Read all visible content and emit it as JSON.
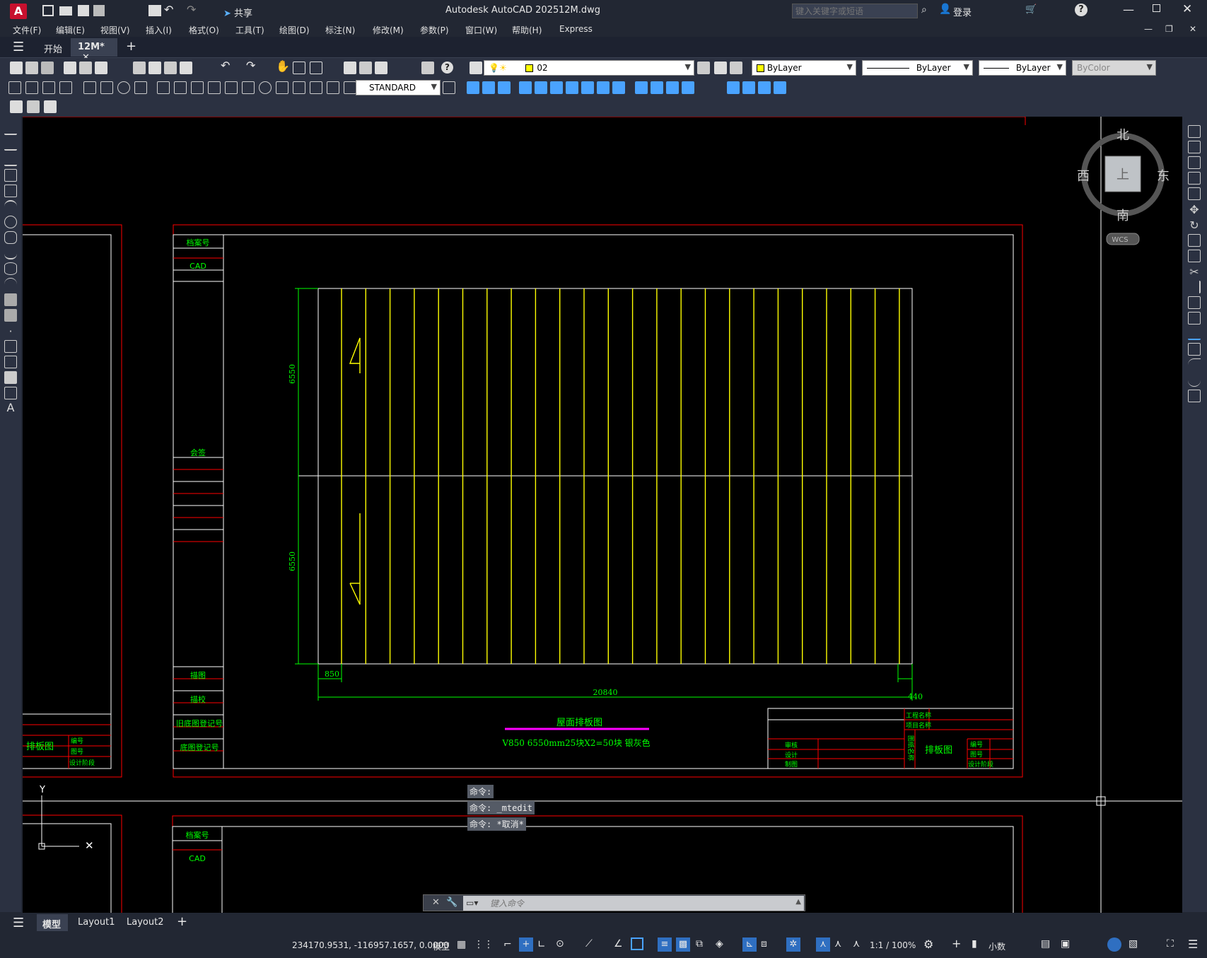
{
  "window": {
    "title": "Autodesk AutoCAD 2025",
    "file": "12M.dwg",
    "share": "共享",
    "search_placeholder": "键入关键字或短语",
    "login": "登录"
  },
  "menu": [
    "文件(F)",
    "编辑(E)",
    "视图(V)",
    "插入(I)",
    "格式(O)",
    "工具(T)",
    "绘图(D)",
    "标注(N)",
    "修改(M)",
    "参数(P)",
    "窗口(W)",
    "帮助(H)",
    "Express"
  ],
  "tabs": {
    "start": "开始",
    "doc": "12M*"
  },
  "toolbar": {
    "layer_value": "02",
    "color": "ByLayer",
    "linetype": "ByLayer",
    "lineweight": "ByLayer",
    "plotstyle": "ByColor",
    "textstyle": "STANDARD"
  },
  "viewcube": {
    "north": "北",
    "south": "南",
    "east": "东",
    "west": "西",
    "face": "上",
    "wcs": "WCS"
  },
  "drawing": {
    "left_col_labels": [
      "档案号",
      "CAD",
      "会签",
      "描图",
      "描校",
      "旧底图登记号",
      "底图登记号"
    ],
    "dim_left_top": "6550",
    "dim_left_bottom": "6550",
    "dim_bottom_left": "850",
    "dim_bottom_total": "20840",
    "dim_bottom_right": "440",
    "caption_title": "屋面排板图",
    "caption_note": "V850 6550mm25块X2=50块 银灰色",
    "titleblock": {
      "drawing_name": "排板图",
      "review": "审核",
      "design": "设计",
      "draw": "制图",
      "project_name": "工程名称",
      "project_item": "项目名称",
      "num": "编号",
      "sheet": "图号",
      "phase": "设计阶段",
      "sheet_title_left": "排板图",
      "company": "图纸名称"
    },
    "left_sheet_title": "排板图",
    "left_sheet_labels": [
      "编号",
      "图号",
      "设计阶段"
    ],
    "lower_sheet_labels": [
      "档案号",
      "CAD"
    ]
  },
  "commands": {
    "history": [
      "命令:",
      "命令: _mtedit",
      "命令: *取消*"
    ],
    "input_placeholder": "键入命令"
  },
  "layouts": {
    "model": "模型",
    "layout1": "Layout1",
    "layout2": "Layout2"
  },
  "status": {
    "coords": "234170.9531, -116957.1657, 0.0000",
    "space": "模型",
    "scale": "1:1 / 100%",
    "units": "小数"
  },
  "colors": {
    "bg": "#000000",
    "frame_red": "#ff0000",
    "panel_yellow": "#ffff00",
    "dim_green": "#00ff00",
    "magenta": "#ff00ff"
  }
}
